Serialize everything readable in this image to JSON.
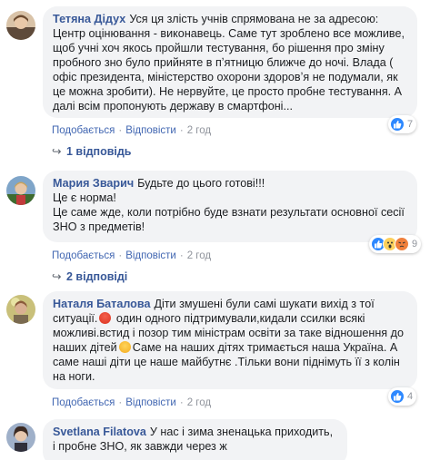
{
  "comments": [
    {
      "author": "Тетяна Дідух",
      "text": "Уся ця злість учнів спрямована не за адресою: Центр оцінювання - виконавець. Саме тут зроблено все можливе, щоб учні хоч якось пройшли тестування, бо рішення про зміну пробного зно було прийняте в пʼятницю ближче до ночі. Влада ( офіс президента, міністерство охорони здоровʼя не подумали, як це можна зробити). Не нервуйте, це просто пробне тестування. А далі всім пропонують державу в смартфоні...",
      "like_label": "Подобається",
      "reply_label": "Відповісти",
      "time": "2 год",
      "reactions_count": "7",
      "replies_label": "1 відповідь"
    },
    {
      "author": "Мария Зварич",
      "text_lines": [
        "Будьте до цього готові!!!",
        "Це є норма!",
        "Це саме жде, коли потрібно буде взнати результати основної сесії ЗНО з предметів!"
      ],
      "like_label": "Подобається",
      "reply_label": "Відповісти",
      "time": "2 год",
      "reactions_count": "9",
      "replies_label": "2 відповіді"
    },
    {
      "author": "Наталя Баталова",
      "text_a": "Діти змушені були самі шукати вихід з тої ситуації.",
      "text_b": " один одного підтримували,кидали ссилки всякі можливі.встид і позор тим міністрам освіти за таке відношення до наших дітей",
      "text_c": "Саме на наших дітях тримається наша Україна. А саме наші діти це наше майбутнє .Тільки вони піднімуть її з колін на ноги.",
      "like_label": "Подобається",
      "reply_label": "Відповісти",
      "time": "2 год",
      "reactions_count": "4"
    },
    {
      "author": "Svetlana Filatova",
      "text": "У нас і зима зненацька приходить, і пробне ЗНО, як завжди через ж"
    }
  ],
  "colors": {
    "author": "#385898",
    "link": "#4267b2",
    "bubble": "#f2f3f5",
    "like_reaction": "#2d88ff",
    "wow_reaction": "#fcd05d",
    "angry_reaction": "#f0803c"
  },
  "icons": [
    "like-reaction-icon",
    "wow-reaction-icon",
    "angry-reaction-icon",
    "reply-arrow-icon",
    "angry-face-emoji-icon",
    "sad-face-emoji-icon"
  ]
}
